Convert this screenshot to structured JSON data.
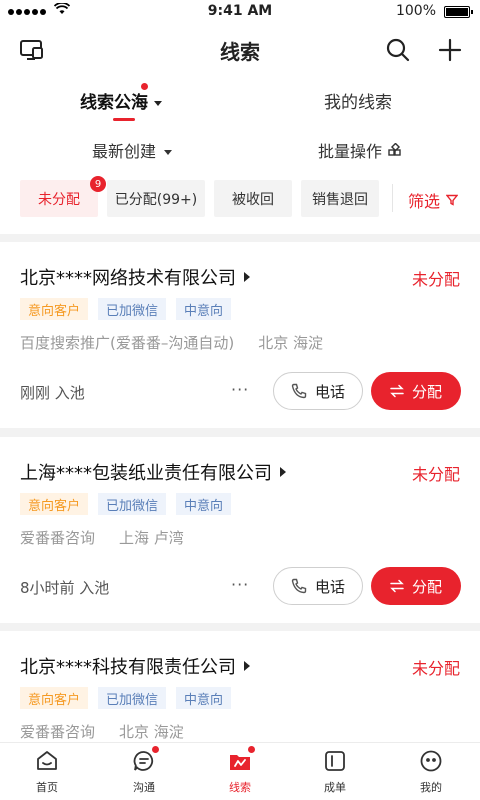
{
  "status": {
    "time": "9:41 AM",
    "battery": "100%"
  },
  "header": {
    "title": "线索"
  },
  "tabs": {
    "public_label": "线索公海",
    "mine_label": "我的线索"
  },
  "sort": {
    "newest_label": "最新创建",
    "batch_label": "批量操作"
  },
  "chips": {
    "unassigned": "未分配",
    "unassigned_badge": "9",
    "assigned": "已分配(99+)",
    "recycled": "被收回",
    "returned": "销售退回",
    "filter": "筛选"
  },
  "colors": {
    "accent": "#e8232d",
    "tag_orange": "#f59a23",
    "tag_blue": "#5a7fb8"
  },
  "leads": [
    {
      "company": "北京****网络技术有限公司",
      "state": "未分配",
      "tags": [
        "意向客户",
        "已加微信",
        "中意向"
      ],
      "source": "百度搜索推广(爱番番–沟通自动)",
      "location": "北京 海淀",
      "entered": "刚刚 入池",
      "more": "···",
      "call_label": "电话",
      "assign_label": "分配"
    },
    {
      "company": "上海****包装纸业责任有限公司",
      "state": "未分配",
      "tags": [
        "意向客户",
        "已加微信",
        "中意向"
      ],
      "source": "爱番番咨询",
      "location": "上海 卢湾",
      "entered": "8小时前 入池",
      "more": "···",
      "call_label": "电话",
      "assign_label": "分配"
    },
    {
      "company": "北京****科技有限责任公司",
      "state": "未分配",
      "tags": [
        "意向客户",
        "已加微信",
        "中意向"
      ],
      "source": "爱番番咨询",
      "location": "北京 海淀"
    }
  ],
  "tabbar": [
    {
      "label": "首页",
      "icon": "home-icon"
    },
    {
      "label": "沟通",
      "icon": "chat-icon"
    },
    {
      "label": "线索",
      "icon": "leads-icon"
    },
    {
      "label": "成单",
      "icon": "deal-icon"
    },
    {
      "label": "我的",
      "icon": "profile-icon"
    }
  ]
}
